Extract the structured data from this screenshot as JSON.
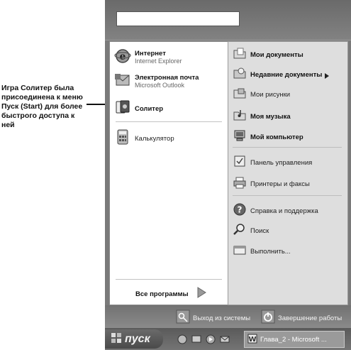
{
  "annotation": {
    "text": "Игра Солитер была присоединена к меню Пуск (Start) для более быстрого доступа к ней"
  },
  "start_menu": {
    "left_items": [
      {
        "title": "Интернет",
        "subtitle": "Internet Explorer",
        "icon": "ie-icon"
      },
      {
        "title": "Электронная почта",
        "subtitle": "Microsoft Outlook",
        "icon": "outlook-icon"
      },
      {
        "title": "Солитер",
        "icon": "solitaire-icon"
      },
      {
        "title": "Калькулятор",
        "icon": "calculator-icon"
      }
    ],
    "all_programs": "Все программы",
    "right_items": [
      {
        "label": "Мои документы",
        "icon": "folder-docs-icon"
      },
      {
        "label": "Недавние документы",
        "icon": "recent-docs-icon"
      },
      {
        "label": "Мои рисунки",
        "icon": "folder-pictures-icon"
      },
      {
        "label": "Моя музыка",
        "icon": "folder-music-icon"
      },
      {
        "label": "Мой компьютер",
        "icon": "my-computer-icon"
      },
      {
        "label": "Панель управления",
        "icon": "control-panel-icon"
      },
      {
        "label": "Принтеры и факсы",
        "icon": "printer-icon"
      },
      {
        "label": "Справка и поддержка",
        "icon": "help-icon"
      },
      {
        "label": "Поиск",
        "icon": "search-icon"
      },
      {
        "label": "Выполнить...",
        "icon": "run-icon"
      }
    ],
    "logoff": "Выход из системы",
    "shutdown": "Завершение работы"
  },
  "taskbar": {
    "start_label": "пуск",
    "task_label": "Глава_2 - Microsoft ..."
  }
}
